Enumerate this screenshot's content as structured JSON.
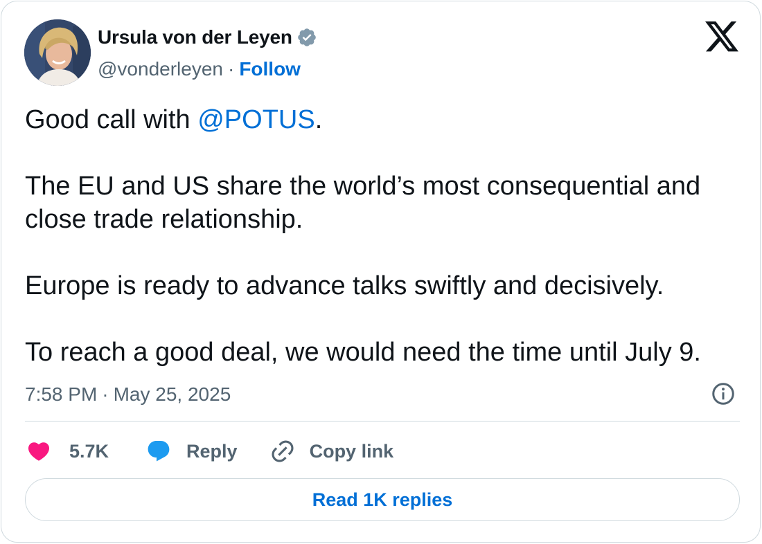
{
  "author": {
    "name": "Ursula von der Leyen",
    "handle": "@vonderleyen",
    "separator": "·",
    "follow_label": "Follow"
  },
  "tweet": {
    "line1_prefix": "Good call with ",
    "line1_mention": "@POTUS",
    "line1_suffix": ".",
    "para2": "The EU and US share the world’s most consequential and close trade relationship.",
    "para3": "Europe is ready to advance talks swiftly and decisively.",
    "para4": "To reach a good deal, we would need the time until July 9."
  },
  "meta": {
    "time": "7:58 PM",
    "separator": "·",
    "date": "May 25, 2025"
  },
  "actions": {
    "likes": "5.7K",
    "reply_label": "Reply",
    "copy_label": "Copy link"
  },
  "read_replies_label": "Read 1K replies",
  "colors": {
    "accent": "#006fd6",
    "like": "#f91880",
    "reply": "#1d9bf0",
    "muted": "#536471",
    "verified": "#829aab"
  },
  "icons": [
    "verified-badge-icon",
    "x-logo-icon",
    "info-icon",
    "heart-icon",
    "reply-bubble-icon",
    "link-icon"
  ]
}
